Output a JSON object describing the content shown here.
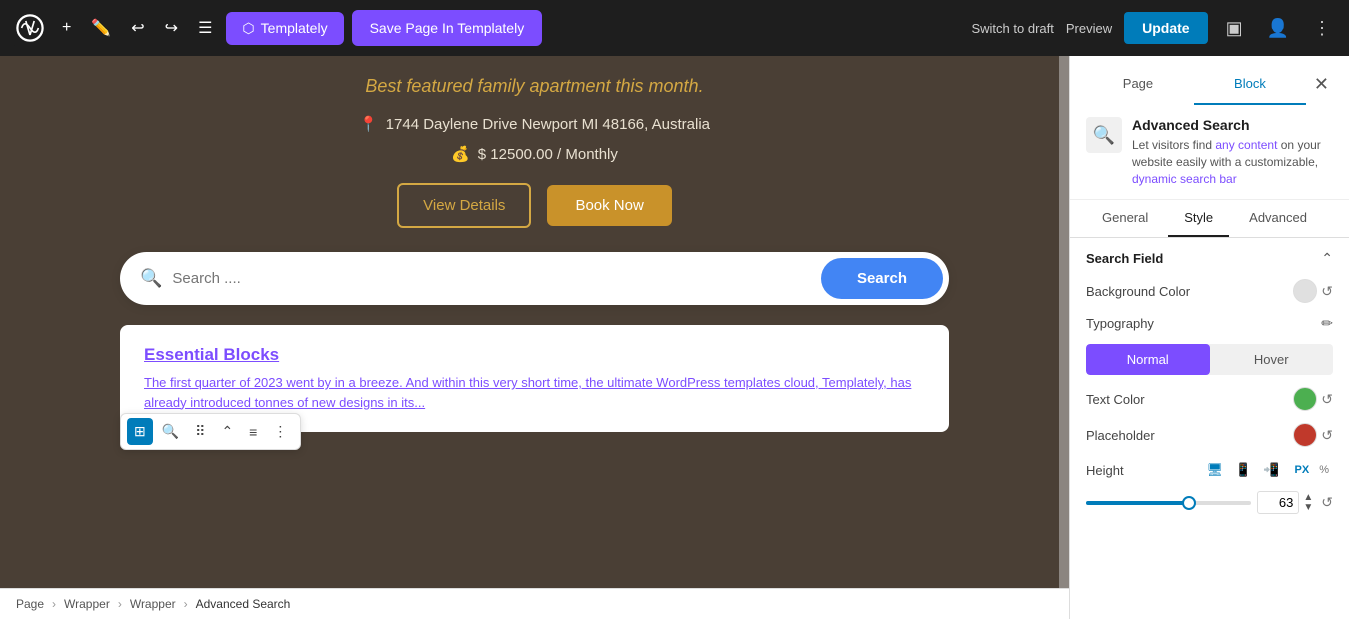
{
  "topbar": {
    "add_label": "+",
    "templately_label": "Templately",
    "save_label": "Save Page In Templately",
    "switch_draft_label": "Switch to draft",
    "preview_label": "Preview",
    "update_label": "Update"
  },
  "canvas": {
    "featured_text": "Best featured family apartment this month.",
    "location": "1744 Daylene Drive Newport MI 48166, Australia",
    "price": "$ 12500.00 / Monthly",
    "view_details_label": "View Details",
    "book_now_label": "Book Now",
    "search_placeholder": "Search ....",
    "search_button_label": "Search",
    "result_title": "Essential Blocks",
    "result_desc": "The first quarter of 2023 went by in a breeze. And within this very short time, the ultimate WordPress templates cloud, Templately, has already introduced tonnes of new designs in its..."
  },
  "breadcrumb": {
    "items": [
      "Page",
      "Wrapper",
      "Wrapper",
      "Advanced Search"
    ]
  },
  "panel": {
    "page_tab": "Page",
    "block_tab": "Block",
    "block_name": "Advanced Search",
    "block_desc": "Let visitors find any content on your website easily with a customizable, dynamic search bar",
    "general_tab": "General",
    "style_tab": "Style",
    "advanced_tab": "Advanced",
    "search_field_section": "Search Field",
    "background_color_label": "Background Color",
    "typography_label": "Typography",
    "normal_label": "Normal",
    "hover_label": "Hover",
    "text_color_label": "Text Color",
    "placeholder_label": "Placeholder",
    "height_label": "Height",
    "height_value": "63",
    "height_unit_px": "PX",
    "height_unit_pct": "%"
  },
  "colors": {
    "text_color": "#4caf50",
    "placeholder_color": "#c0392b",
    "background_color_circle": "#e0e0e0"
  }
}
